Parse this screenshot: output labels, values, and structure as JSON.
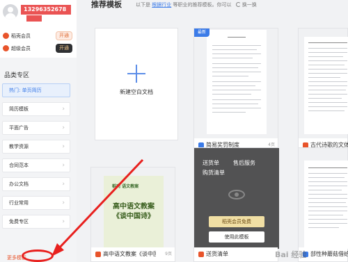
{
  "user": {
    "phone": "13296352678",
    "vip_rows": [
      {
        "label": "稻壳会员",
        "button": "开通",
        "icon_color": "#e8542b"
      },
      {
        "label": "超级会员",
        "button": "开通",
        "icon_color": "#e8542b"
      }
    ]
  },
  "sidebar": {
    "title": "品类专区",
    "items": [
      {
        "label": "热门: 单页简历",
        "active": true
      },
      {
        "label": "简历模板"
      },
      {
        "label": "平面广告"
      },
      {
        "label": "教学资源"
      },
      {
        "label": "合同范本"
      },
      {
        "label": "办公文档"
      },
      {
        "label": "行业常用"
      },
      {
        "label": "免费专区"
      }
    ],
    "more": "更多模板"
  },
  "main": {
    "heading": "推荐模板",
    "subtitle_prefix": "以下是",
    "subtitle_link": "根据行业",
    "subtitle_suffix": "等职业的推荐模板。你可以",
    "refresh": "换一换",
    "new_doc_label": "新建空白文档",
    "cards": [
      {
        "title": "简易奖罚制度",
        "pages": "4页",
        "badge": "最新",
        "icon_color": "#3b7be8"
      },
      {
        "title": "古代诗歌的文体特征",
        "pages": "",
        "icon_color": "#e8542b"
      },
      {
        "title": "高中语文教案《谈中国诗》",
        "pages": "9页",
        "icon_color": "#e8542b",
        "thumb_brand": "稻壳 语文教案",
        "thumb_title_1": "高中语文教案",
        "thumb_title_2": "《谈中国诗》"
      },
      {
        "title": "送货清单",
        "pages": "",
        "icon_color": "#e8542b",
        "overlay_tags": [
          "送货单",
          "售后服务",
          "购货清单"
        ],
        "overlay_gold_button": "稻壳会员免费",
        "overlay_white_button": "使用此模板"
      },
      {
        "title": "部性种蘑菇借给我们",
        "pages": "",
        "icon_color": "#3b7be8"
      }
    ]
  },
  "watermark": "Bai 经验"
}
